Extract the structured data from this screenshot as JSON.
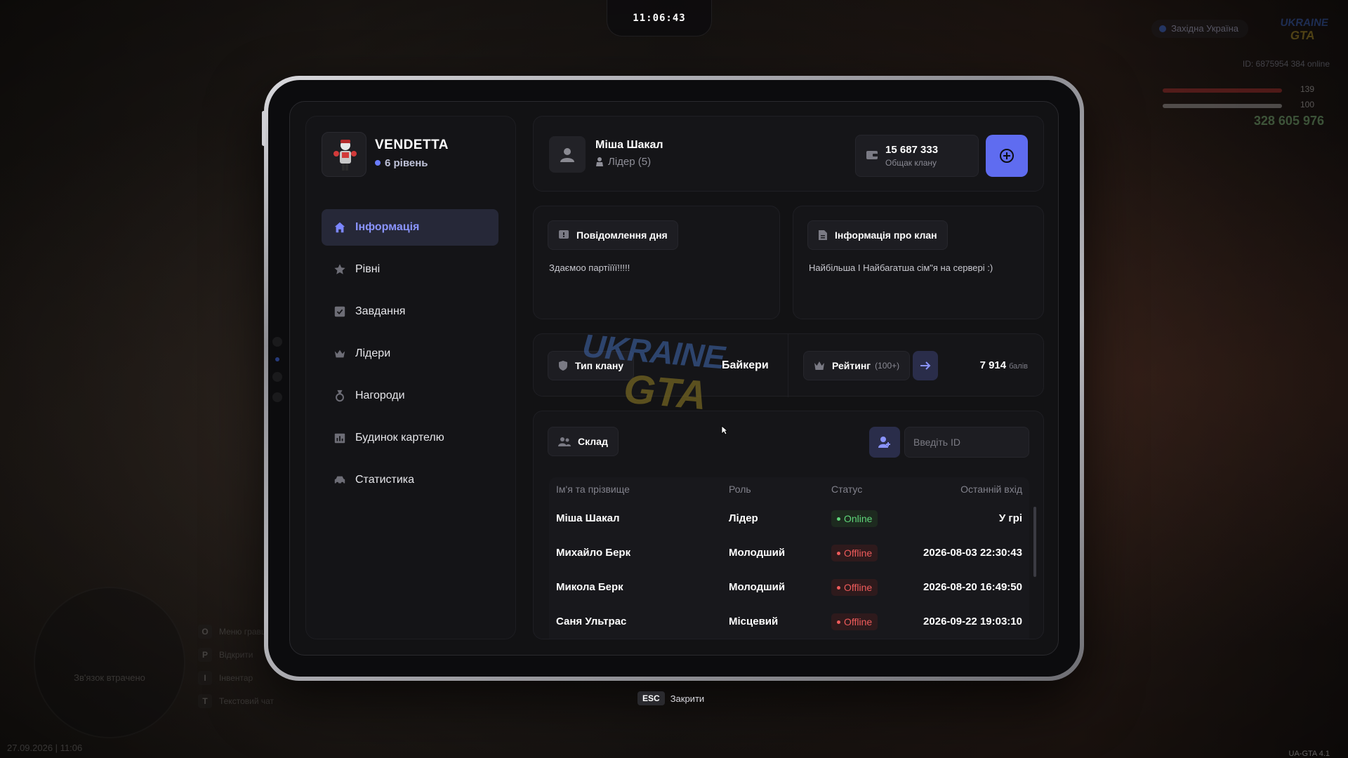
{
  "hud": {
    "clock": "11:06:43",
    "region": "Західна Україна",
    "brand_top": "UKRAINE",
    "brand_bottom": "GTA",
    "player_id": "ID: 6875954   384 online",
    "health": "139",
    "armor": "100",
    "money": "328 605 976",
    "radar_text": "Зв'язок втрачено",
    "keys": [
      {
        "key": "O",
        "label": "Меню гравця"
      },
      {
        "key": "P",
        "label": "Відкрити"
      },
      {
        "key": "I",
        "label": "Інвентар"
      },
      {
        "key": "T",
        "label": "Текстовий чат"
      }
    ],
    "date": "27.09.2026 | 11:06",
    "version": "UA-GTA 4.1"
  },
  "clan": {
    "name": "VENDETTA",
    "level": "6 рівень"
  },
  "nav": [
    {
      "label": "Інформація",
      "icon": "home-icon",
      "active": true
    },
    {
      "label": "Рівні",
      "icon": "star-icon",
      "active": false
    },
    {
      "label": "Завдання",
      "icon": "checkbox-icon",
      "active": false
    },
    {
      "label": "Лідери",
      "icon": "crown-icon",
      "active": false
    },
    {
      "label": "Нагороди",
      "icon": "medal-icon",
      "active": false
    },
    {
      "label": "Будинок картелю",
      "icon": "building-icon",
      "active": false
    },
    {
      "label": "Статистика",
      "icon": "car-icon",
      "active": false
    }
  ],
  "profile": {
    "name": "Міша Шакал",
    "role": "Лідер (5)",
    "balance": "15 687 333",
    "balance_label": "Общак клану"
  },
  "motd": {
    "title": "Повідомлення дня",
    "text": "Здаємоо партіїїї!!!!!"
  },
  "clan_info": {
    "title": "Інформація про клан",
    "text": "Найбільша І Найбагатша сім\"я на сервері :)"
  },
  "clan_type": {
    "label": "Тип клану",
    "value": "Байкери"
  },
  "rating": {
    "label": "Рейтинг",
    "sub": "(100+)",
    "score": "7 914",
    "unit": "балів"
  },
  "warehouse": {
    "title": "Склад",
    "input_placeholder": "Введіть ID"
  },
  "members_table": {
    "headers": [
      "Ім'я та прізвище",
      "Роль",
      "Статус",
      "Останній вхід"
    ],
    "rows": [
      {
        "name": "Міша Шакал",
        "role": "Лідер",
        "status": "Online",
        "last": "У грі"
      },
      {
        "name": "Михайло Берк",
        "role": "Молодший",
        "status": "Offline",
        "last": "2026-08-03 22:30:43"
      },
      {
        "name": "Микола Берк",
        "role": "Молодший",
        "status": "Offline",
        "last": "2026-08-20 16:49:50"
      },
      {
        "name": "Саня Ультрас",
        "role": "Місцевий",
        "status": "Offline",
        "last": "2026-09-22 19:03:10"
      }
    ]
  },
  "watermark": {
    "top": "UKRAINE",
    "bottom": "GTA"
  },
  "footer": {
    "esc_key": "ESC",
    "esc_label": "Закрити"
  },
  "colors": {
    "accent": "#5f6cf0",
    "online": "#5fd67a",
    "offline": "#ef5b5b"
  }
}
